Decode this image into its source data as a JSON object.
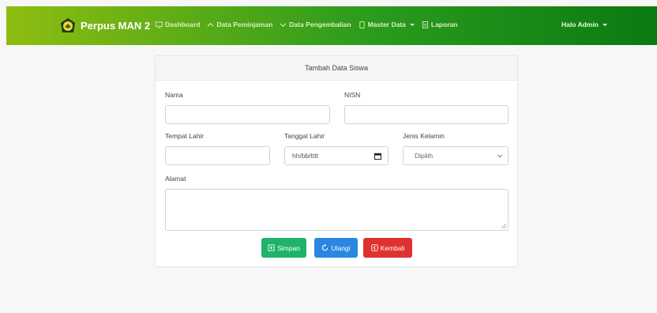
{
  "navbar": {
    "brand": "Perpus MAN 2",
    "items": [
      {
        "label": "Dashboard",
        "icon": "monitor-icon"
      },
      {
        "label": "Data Peminjaman",
        "icon": "up-arrow-icon"
      },
      {
        "label": "Data Pengembalian",
        "icon": "down-arrow-icon"
      },
      {
        "label": "Master Data",
        "icon": "document-icon"
      },
      {
        "label": "Laporan",
        "icon": "report-icon"
      }
    ],
    "user": "Halo Admin"
  },
  "form": {
    "title": "Tambah Data Siswa",
    "nama_label": "Nama",
    "nisn_label": "NISN",
    "tempat_label": "Tempat Lahir",
    "tanggal_label": "Tanggal Lahir",
    "tanggal_placeholder": "hh/bb/tttt",
    "jk_label": "Jenis Kelamin",
    "jk_selected": "Dipilih",
    "alamat_label": "Alamat"
  },
  "buttons": {
    "save": "Simpan",
    "reset": "Ulangi",
    "back": "Kembali"
  },
  "colors": {
    "navbar_start": "#8ebd10",
    "navbar_end": "#0a7a12",
    "save": "#1fb36a",
    "reset": "#2a86e0",
    "back": "#e03131"
  }
}
